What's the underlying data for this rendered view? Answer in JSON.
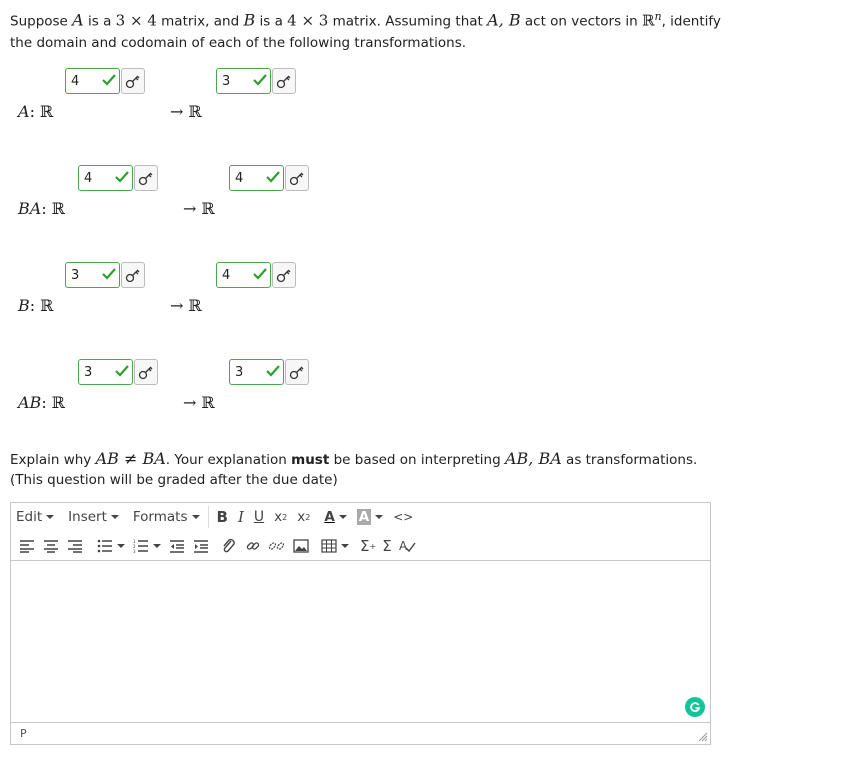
{
  "intro": {
    "t1": "Suppose ",
    "A": "A",
    "t2": " is a ",
    "dimA": "3 × 4",
    "t3": " matrix, and ",
    "B": "B",
    "t4": " is a ",
    "dimB": "4 × 3",
    "t5": " matrix. Assuming that ",
    "AB": "A, B",
    "t6": " act on vectors in ",
    "Rn": "ℝ",
    "n": "n",
    "t7": ", identify",
    "line2": "the domain and codomain of each of the following transformations."
  },
  "rows": [
    {
      "label": "A",
      "domain": "4",
      "codomain": "3"
    },
    {
      "label": "BA",
      "domain": "4",
      "codomain": "4"
    },
    {
      "label": "B",
      "domain": "3",
      "codomain": "4"
    },
    {
      "label": "AB",
      "domain": "3",
      "codomain": "3"
    }
  ],
  "row_suffix": ": ℝ",
  "arrow": "→ ℝ",
  "explain": {
    "t1": "Explain why ",
    "neq": "AB ≠ BA",
    "t2": ". Your explanation ",
    "must": "must",
    "t3": " be based on interpreting ",
    "ABBA": "AB, BA",
    "t4": " as transformations.",
    "line2": "(This question will be graded after the due date)"
  },
  "editor": {
    "menu_edit": "Edit",
    "menu_insert": "Insert",
    "menu_formats": "Formats",
    "bold": "B",
    "italic": "I",
    "underline": "U",
    "sub": "x",
    "sup": "x",
    "textcolor": "A",
    "bgcolor": "A",
    "code": "<>",
    "sigma1": "Σ",
    "sigma2": "Σ",
    "status_path": "P"
  },
  "colors": {
    "correct": "#4ca64c",
    "grammarly": "#15c39a"
  }
}
